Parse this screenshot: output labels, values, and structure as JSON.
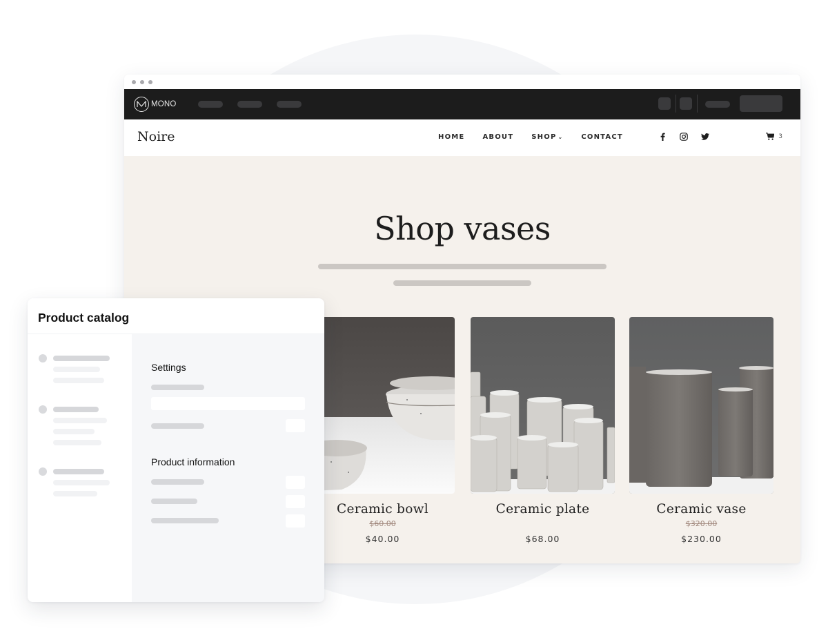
{
  "browser": {
    "window_dots": 3,
    "topbar": {
      "logo_text": "MONO",
      "logo_icon": "mono-monogram-icon"
    },
    "site": {
      "brand": "Noire",
      "nav": [
        {
          "label": "HOME"
        },
        {
          "label": "ABOUT"
        },
        {
          "label": "SHOP",
          "has_dropdown": true,
          "chevron": "⌄"
        },
        {
          "label": "CONTACT"
        }
      ],
      "social": [
        {
          "icon": "facebook-icon"
        },
        {
          "icon": "instagram-icon"
        },
        {
          "icon": "twitter-icon"
        }
      ],
      "cart": {
        "icon": "cart-icon",
        "count": "3"
      }
    },
    "hero": {
      "title": "Shop vases"
    },
    "products": [
      {
        "name": "Ceramic bowl",
        "old_price": "$60.00",
        "price": "$40.00",
        "image": "ceramic-bowls-photo"
      },
      {
        "name": "Ceramic plate",
        "old_price": "",
        "price": "$68.00",
        "image": "ceramic-pitchers-photo"
      },
      {
        "name": "Ceramic vase",
        "old_price": "$320.00",
        "price": "$230.00",
        "image": "ceramic-vases-photo"
      }
    ]
  },
  "panel": {
    "title": "Product catalog",
    "sections": [
      {
        "title": "Settings"
      },
      {
        "title": "Product information"
      }
    ]
  },
  "colors": {
    "topbar": "#1c1c1c",
    "page_bg": "#f5f1ec",
    "old_price": "#a0877c",
    "panel_main_bg": "#f6f7f9"
  }
}
